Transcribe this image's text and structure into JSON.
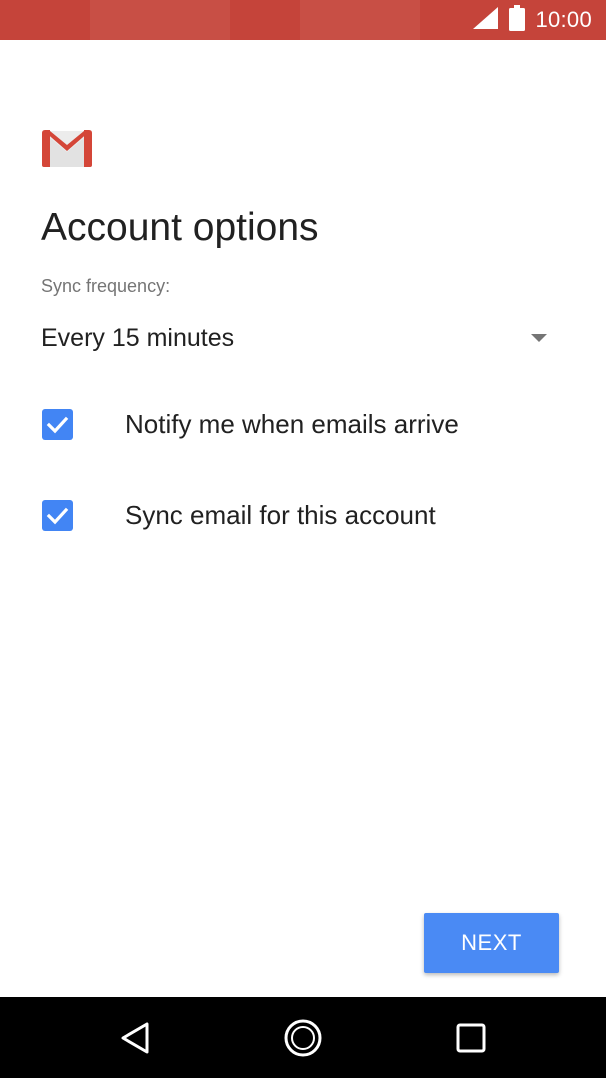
{
  "status_bar": {
    "time": "10:00",
    "background": "#c5443a",
    "icons": [
      "signal-icon",
      "battery-icon"
    ]
  },
  "app": {
    "logo": "gmail-logo"
  },
  "page": {
    "title": "Account options",
    "sync_label": "Sync frequency:",
    "sync_value": "Every 15 minutes"
  },
  "options": [
    {
      "label": "Notify me when emails arrive",
      "checked": true
    },
    {
      "label": "Sync email for this account",
      "checked": true
    }
  ],
  "actions": {
    "next_label": "NEXT",
    "accent": "#4a8af4"
  },
  "nav": {
    "icons": [
      "back-icon",
      "home-icon",
      "recents-icon"
    ]
  }
}
